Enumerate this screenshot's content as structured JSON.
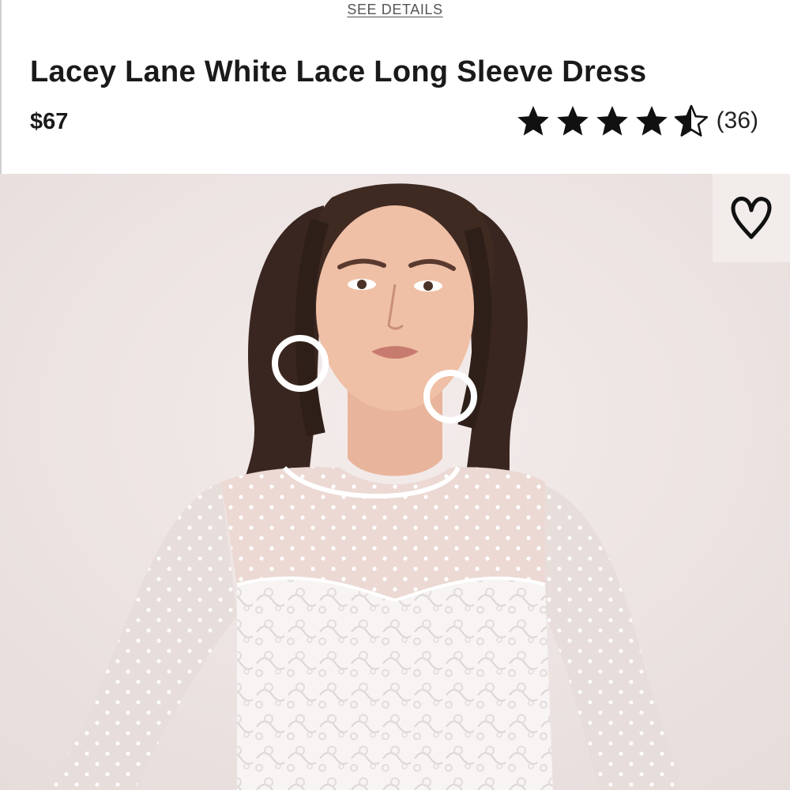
{
  "header": {
    "see_details": "SEE DETAILS"
  },
  "product": {
    "title": "Lacey Lane White Lace Long Sleeve Dress",
    "price": "$67",
    "rating": 4.5,
    "max_rating": 5,
    "review_count": "(36)"
  },
  "icons": {
    "star": "star-icon",
    "half_star": "half-star-icon",
    "heart": "heart-icon"
  },
  "colors": {
    "text": "#1a1a1a",
    "star": "#111111",
    "photo_background": "#ece4e2"
  }
}
